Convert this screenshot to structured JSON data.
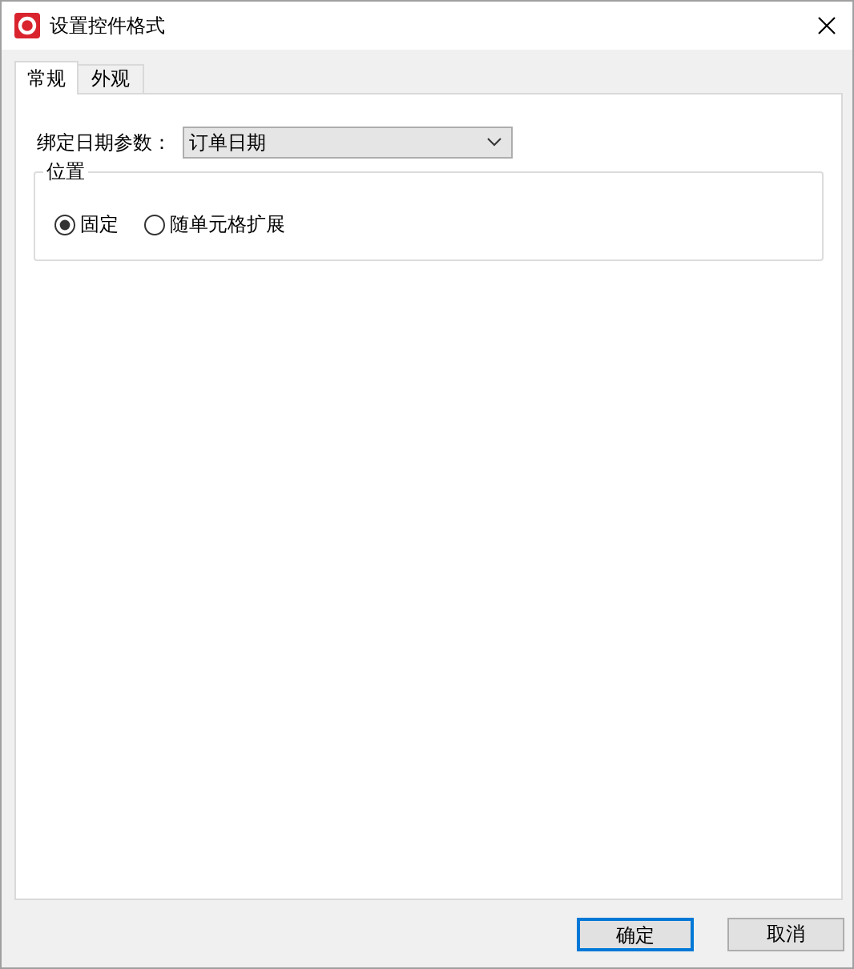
{
  "window": {
    "title": "设置控件格式"
  },
  "tabs": [
    {
      "label": "常规",
      "selected": true
    },
    {
      "label": "外观",
      "selected": false
    }
  ],
  "bind_field": {
    "label": "绑定日期参数：",
    "value": "订单日期"
  },
  "position_group": {
    "title": "位置",
    "options": [
      {
        "label": "固定",
        "selected": true
      },
      {
        "label": "随单元格扩展",
        "selected": false
      }
    ]
  },
  "buttons": [
    {
      "label": "确定",
      "default": true
    },
    {
      "label": "取消",
      "default": false
    }
  ]
}
